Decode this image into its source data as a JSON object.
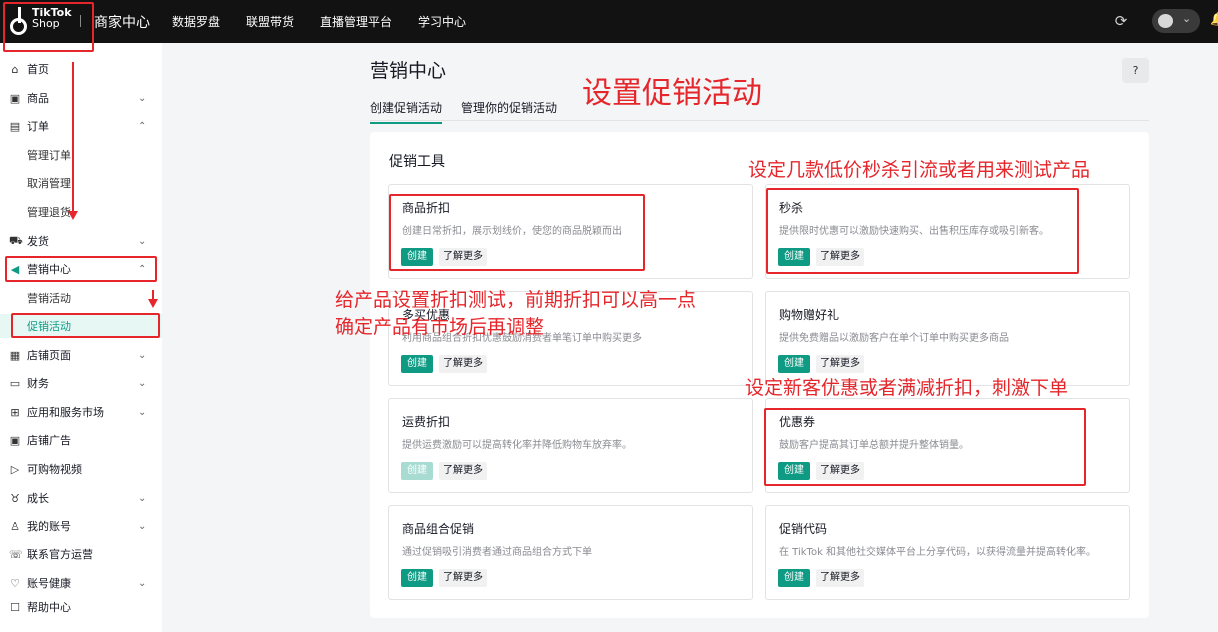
{
  "topbar": {
    "logo_line1": "TikTok",
    "logo_line2": "Shop",
    "merchant_center": "商家中心",
    "nav": [
      "数据罗盘",
      "联盟带货",
      "直播管理平台",
      "学习中心"
    ]
  },
  "sidebar": {
    "items": [
      {
        "label": "首页",
        "icon": "home-icon"
      },
      {
        "label": "商品",
        "icon": "product-icon",
        "chevron": "⌄"
      },
      {
        "label": "订单",
        "icon": "order-icon",
        "chevron": "⌃"
      },
      {
        "label": "管理订单"
      },
      {
        "label": "取消管理"
      },
      {
        "label": "管理退货"
      },
      {
        "label": "发货",
        "icon": "shipping-icon",
        "chevron": "⌄"
      },
      {
        "label": "营销中心",
        "icon": "megaphone-icon",
        "chevron": "⌃"
      },
      {
        "label": "营销活动"
      },
      {
        "label": "促销活动"
      },
      {
        "label": "店铺页面",
        "icon": "store-icon",
        "chevron": "⌄"
      },
      {
        "label": "财务",
        "icon": "finance-icon",
        "chevron": "⌄"
      },
      {
        "label": "应用和服务市场",
        "icon": "apps-icon",
        "chevron": "⌄"
      },
      {
        "label": "店铺广告",
        "icon": "ads-icon"
      },
      {
        "label": "可购物视频",
        "icon": "video-icon"
      },
      {
        "label": "成长",
        "icon": "growth-icon",
        "chevron": "⌄"
      },
      {
        "label": "我的账号",
        "icon": "account-icon",
        "chevron": "⌄"
      },
      {
        "label": "联系官方运营",
        "icon": "contact-icon"
      },
      {
        "label": "账号健康",
        "icon": "health-icon",
        "chevron": "⌄"
      },
      {
        "label": "帮助中心",
        "icon": "help-center-icon"
      }
    ]
  },
  "main": {
    "title": "营销中心",
    "help": "?",
    "tabs": [
      {
        "label": "创建促销活动",
        "active": true
      },
      {
        "label": "管理你的促销活动",
        "active": false
      }
    ],
    "panel_title": "促销工具",
    "create_label": "创建",
    "more_label": "了解更多",
    "cards": [
      {
        "title": "商品折扣",
        "desc": "创建日常折扣，展示划线价，使您的商品脱颖而出",
        "enabled": true
      },
      {
        "title": "秒杀",
        "desc": "提供限时优惠可以激励快速购买、出售积压库存或吸引新客。",
        "enabled": true
      },
      {
        "title": "多买优惠",
        "desc": "利用商品组合折扣优惠鼓励消费者单笔订单中购买更多",
        "enabled": true
      },
      {
        "title": "购物赠好礼",
        "desc": "提供免费赠品以激励客户在单个订单中购买更多商品",
        "enabled": true
      },
      {
        "title": "运费折扣",
        "desc": "提供运费激励可以提高转化率并降低购物车放弃率。",
        "enabled": false
      },
      {
        "title": "优惠券",
        "desc": "鼓励客户提高其订单总额并提升整体销量。",
        "enabled": true
      },
      {
        "title": "商品组合促销",
        "desc": "通过促销吸引消费者通过商品组合方式下单",
        "enabled": true
      },
      {
        "title": "促销代码",
        "desc": "在 TikTok 和其他社交媒体平台上分享代码，以获得流量并提高转化率。",
        "enabled": true
      }
    ]
  },
  "annotations": {
    "heading": "设置促销活动",
    "flash_sale_note": "设定几款低价秒杀引流或者用来测试产品",
    "discount_note_1": "给产品设置折扣测试，前期折扣可以高一点",
    "discount_note_2": "确定产品有市场后再调整",
    "coupon_note": "设定新客优惠或者满减折扣，刺激下单",
    "color": "#e5262b"
  },
  "colors": {
    "accent": "#0f9a84",
    "topbar": "#121212"
  }
}
